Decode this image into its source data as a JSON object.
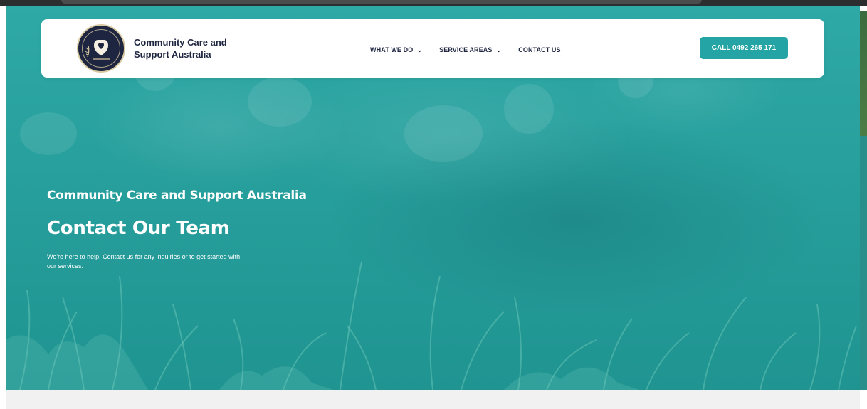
{
  "header": {
    "brand_name": "Community Care and Support Australia",
    "nav": [
      {
        "label": "WHAT WE DO",
        "has_dropdown": true
      },
      {
        "label": "SERVICE AREAS",
        "has_dropdown": true
      },
      {
        "label": "CONTACT US",
        "has_dropdown": false
      }
    ],
    "dropdown_icon": "chevron-down-icon",
    "call_button_label": "CALL 0492 265 171"
  },
  "hero": {
    "eyebrow": "Community Care and Support Australia",
    "title": "Contact Our Team",
    "description": "We're here to help. Contact us for any inquiries or to get started with our services."
  },
  "colors": {
    "accent": "#24a4a4",
    "navy": "#1e2540",
    "hero_overlay": "#2aa3a0",
    "footer_band": "#f1f1f1"
  }
}
